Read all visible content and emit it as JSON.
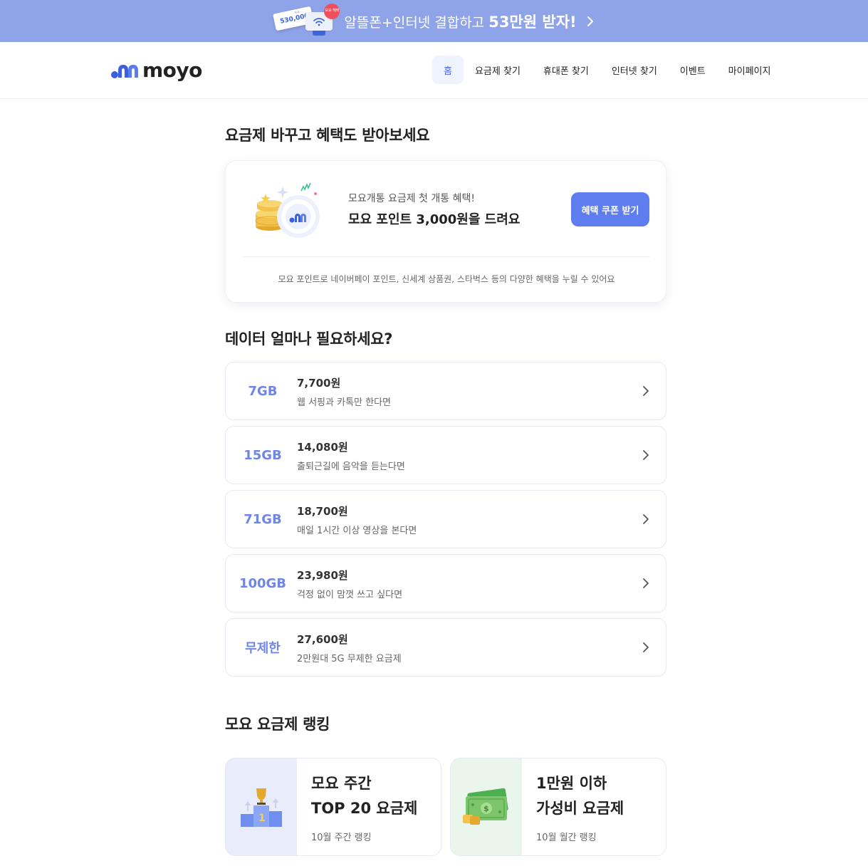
{
  "banner": {
    "ticket_small": "최대",
    "ticket_price": "530,000",
    "badge_text": "모요 혜택",
    "text_prefix": "알뜰폰+인터넷 결합하고 ",
    "text_highlight": "53만원 받자!"
  },
  "header": {
    "logo_text": "moyo",
    "nav": [
      {
        "label": "홈",
        "active": true
      },
      {
        "label": "요금제 찾기"
      },
      {
        "label": "휴대폰 찾기"
      },
      {
        "label": "인터넷 찾기"
      },
      {
        "label": "이벤트"
      },
      {
        "label": "마이페이지"
      }
    ]
  },
  "promo_section": {
    "title": "요금제 바꾸고 혜택도 받아보세요",
    "subtitle": "모요개통 요금제 첫 개통 혜택!",
    "headline": "모요 포인트 3,000원을 드려요",
    "button_label": "혜택 쿠폰 받기",
    "note": "모요 포인트로 네이버페이 포인트, 신세계 상품권, 스타벅스 등의 다양한 혜택을 누릴 수 있어요"
  },
  "data_section": {
    "title": "데이터 얼마나 필요하세요?",
    "items": [
      {
        "amount": "7GB",
        "price": "7,700원",
        "desc": "웹 서핑과 카톡만 한다면"
      },
      {
        "amount": "15GB",
        "price": "14,080원",
        "desc": "출퇴근길에 음악을 듣는다면"
      },
      {
        "amount": "71GB",
        "price": "18,700원",
        "desc": "매일 1시간 이상 영상을 본다면"
      },
      {
        "amount": "100GB",
        "price": "23,980원",
        "desc": "걱정 없이 맘껏 쓰고 싶다면"
      },
      {
        "amount": "무제한",
        "price": "27,600원",
        "desc": "2만원대 5G 무제한 요금제"
      }
    ]
  },
  "ranking_section": {
    "title": "모요 요금제 랭킹",
    "cards": [
      {
        "line1": "모요 주간",
        "line2": "TOP 20 요금제",
        "sub": "10월 주간 랭킹"
      },
      {
        "line1": "1만원 이하",
        "line2": "가성비 요금제",
        "sub": "10월 월간 랭킹"
      }
    ]
  },
  "colors": {
    "banner_bg": "#8fa3e8",
    "accent": "#5e7ef0",
    "data_amount": "#6f86e8"
  }
}
